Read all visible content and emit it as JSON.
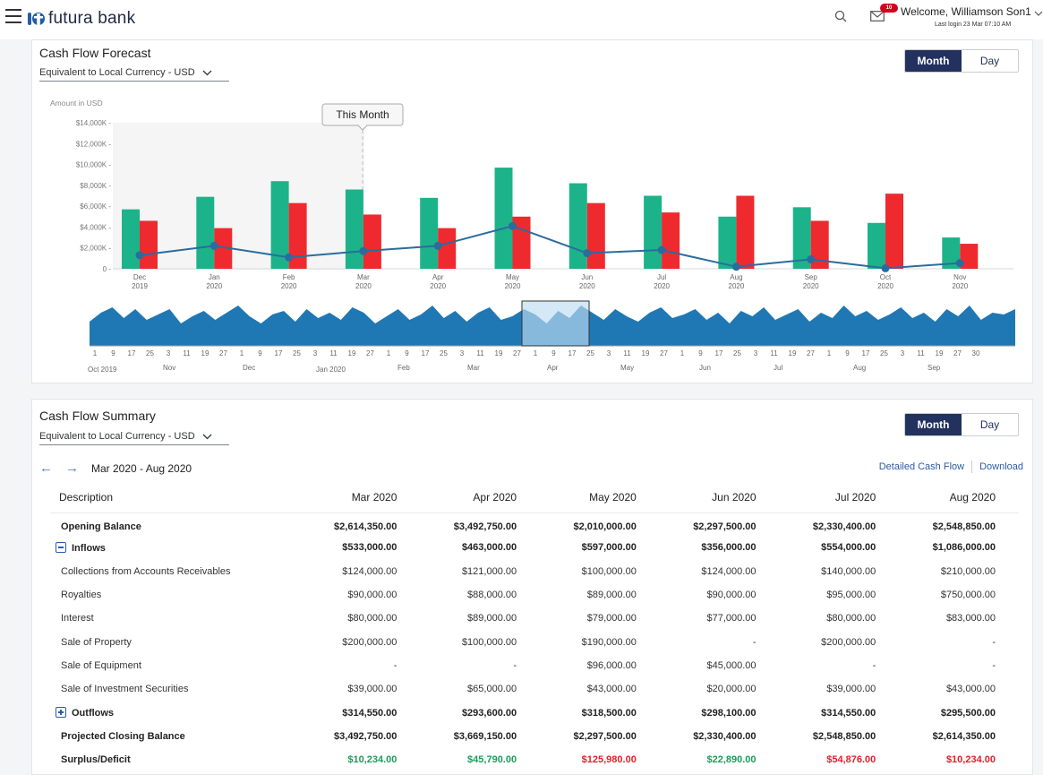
{
  "header": {
    "brand": "futura bank",
    "welcome": "Welcome, Williamson Son1",
    "last_login": "Last login 23 Mar 07:10 AM",
    "mail_badge": "10",
    "accent": "#22315e"
  },
  "forecast": {
    "title": "Cash Flow Forecast",
    "currency": "Equivalent to Local Currency - USD",
    "toggle": {
      "month": "Month",
      "day": "Day",
      "active": "Month"
    },
    "tooltip": "This Month"
  },
  "chart_data": {
    "type": "bar",
    "ylabel": "Amount in USD",
    "ylim": [
      0,
      14000
    ],
    "yticks": [
      "$14,000K -",
      "$12,000K -",
      "$10,000K -",
      "$8,000K -",
      "$6,000K -",
      "$4,000K -",
      "$2,000K -",
      "0 -"
    ],
    "categories": [
      "Dec 2019",
      "Jan 2020",
      "Feb 2020",
      "Mar 2020",
      "Apr 2020",
      "May 2020",
      "Jun 2020",
      "Jul 2020",
      "Aug 2020",
      "Sep 2020",
      "Oct 2020",
      "Nov 2020"
    ],
    "category_months": [
      "Dec",
      "Jan",
      "Feb",
      "Mar",
      "Apr",
      "May",
      "Jun",
      "Jul",
      "Aug",
      "Sep",
      "Oct",
      "Nov"
    ],
    "category_years": [
      "2019",
      "2020",
      "2020",
      "2020",
      "2020",
      "2020",
      "2020",
      "2020",
      "2020",
      "2020",
      "2020",
      "2020"
    ],
    "series": [
      {
        "values": [
          5700,
          6900,
          8400,
          7600,
          6800,
          9700,
          8200,
          7000,
          5000,
          5900,
          4400,
          3000
        ],
        "color": "#1db38a"
      },
      {
        "values": [
          4600,
          3900,
          6300,
          5200,
          3900,
          5000,
          6300,
          5400,
          7000,
          4600,
          7200,
          2400
        ],
        "color": "#ee2a2f"
      },
      {
        "type": "line",
        "values": [
          1300,
          2200,
          1100,
          1700,
          2200,
          4100,
          1500,
          1800,
          200,
          900,
          50,
          550
        ],
        "color": "#2b6c9e"
      }
    ],
    "highlight_index": 3
  },
  "navigator": {
    "day_ticks": [
      "1",
      "9",
      "17",
      "25",
      "3",
      "11",
      "19",
      "27",
      "1",
      "9",
      "17",
      "25",
      "3",
      "11",
      "19",
      "27",
      "1",
      "9",
      "17",
      "25",
      "3",
      "11",
      "19",
      "27",
      "1",
      "9",
      "17",
      "25",
      "3",
      "11",
      "19",
      "27",
      "1",
      "9",
      "17",
      "25",
      "3",
      "11",
      "19",
      "27",
      "1",
      "9",
      "17",
      "25",
      "3",
      "11",
      "19",
      "27",
      "30"
    ],
    "month_labels": [
      "Oct 2019",
      "Nov",
      "Dec",
      "Jan 2020",
      "Feb",
      "Mar",
      "Apr",
      "May",
      "Jun",
      "Jul",
      "Aug",
      "Sep"
    ],
    "color": "#1f78b4"
  },
  "summary": {
    "title": "Cash Flow Summary",
    "currency": "Equivalent to Local Currency - USD",
    "toggle": {
      "month": "Month",
      "day": "Day",
      "active": "Month"
    },
    "period": "Mar 2020 - Aug 2020",
    "links": {
      "detailed": "Detailed Cash Flow",
      "download": "Download"
    },
    "columns": [
      "Description",
      "Mar 2020",
      "Apr 2020",
      "May 2020",
      "Jun 2020",
      "Jul 2020",
      "Aug 2020"
    ],
    "rows": [
      {
        "label": "Opening Balance",
        "style": "bold",
        "values": [
          "$2,614,350.00",
          "$3,492,750.00",
          "$2,010,000.00",
          "$2,297,500.00",
          "$2,330,400.00",
          "$2,548,850.00"
        ]
      },
      {
        "label": "Inflows",
        "style": "bold",
        "expander": "minus",
        "values": [
          "$533,000.00",
          "$463,000.00",
          "$597,000.00",
          "$356,000.00",
          "$554,000.00",
          "$1,086,000.00"
        ]
      },
      {
        "label": "Collections from Accounts Receivables",
        "style": "",
        "values": [
          "$124,000.00",
          "$121,000.00",
          "$100,000.00",
          "$124,000.00",
          "$140,000.00",
          "$210,000.00"
        ]
      },
      {
        "label": "Royalties",
        "style": "",
        "values": [
          "$90,000.00",
          "$88,000.00",
          "$89,000.00",
          "$90,000.00",
          "$95,000.00",
          "$750,000.00"
        ]
      },
      {
        "label": "Interest",
        "style": "",
        "values": [
          "$80,000.00",
          "$89,000.00",
          "$79,000.00",
          "$77,000.00",
          "$80,000.00",
          "$83,000.00"
        ]
      },
      {
        "label": "Sale of Property",
        "style": "",
        "values": [
          "$200,000.00",
          "$100,000.00",
          "$190,000.00",
          "-",
          "$200,000.00",
          "-"
        ]
      },
      {
        "label": "Sale of Equipment",
        "style": "",
        "values": [
          "-",
          "-",
          "$96,000.00",
          "$45,000.00",
          "-",
          "-"
        ]
      },
      {
        "label": "Sale of Investment Securities",
        "style": "",
        "values": [
          "$39,000.00",
          "$65,000.00",
          "$43,000.00",
          "$20,000.00",
          "$39,000.00",
          "$43,000.00"
        ]
      },
      {
        "label": "Outflows",
        "style": "bold",
        "expander": "plus",
        "values": [
          "$314,550.00",
          "$293,600.00",
          "$318,500.00",
          "$298,100.00",
          "$314,550.00",
          "$295,500.00"
        ]
      },
      {
        "label": "Projected Closing Balance",
        "style": "bold",
        "values": [
          "$3,492,750.00",
          "$3,669,150.00",
          "$2,297,500.00",
          "$2,330,400.00",
          "$2,548,850.00",
          "$2,614,350.00"
        ]
      },
      {
        "label": "Surplus/Deficit",
        "style": "bold",
        "values": [
          "$10,234.00",
          "$45,790.00",
          "$125,980.00",
          "$22,890.00",
          "$54,876.00",
          "$10,234.00"
        ],
        "signs": [
          "pos",
          "pos",
          "neg",
          "pos",
          "neg",
          "neg"
        ]
      }
    ]
  }
}
